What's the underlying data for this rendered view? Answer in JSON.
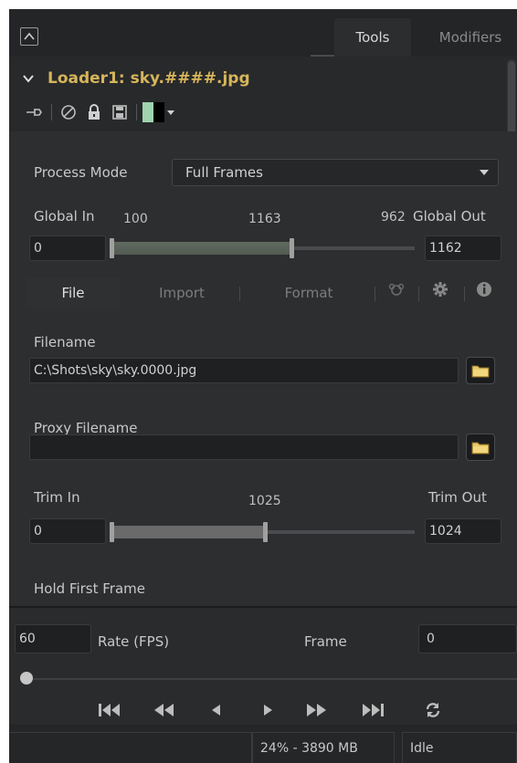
{
  "tabs": {
    "tools": "Tools",
    "modifiers": "Modifiers"
  },
  "tool": {
    "title": "Loader1: sky.####.jpg",
    "icons": [
      "pin-icon",
      "disable-icon",
      "lock-icon",
      "save-icon",
      "color-swatch",
      "chevron-down-icon"
    ],
    "swatch_colors": [
      "#9fd3ad",
      "#000000"
    ]
  },
  "process_mode": {
    "label": "Process Mode",
    "value": "Full Frames"
  },
  "global_range": {
    "in_label": "Global In",
    "out_label": "Global Out",
    "start_marker": "100",
    "end_marker": "1163",
    "length_marker": "962",
    "in_value": "0",
    "out_value": "1162"
  },
  "subtabs": [
    "File",
    "Import",
    "Format"
  ],
  "subtab_icons": [
    "link-icon",
    "gear-icon",
    "info-icon"
  ],
  "filename": {
    "label": "Filename",
    "value": "C:\\Shots\\sky\\sky.0000.jpg"
  },
  "proxy": {
    "label": "Proxy Filename",
    "value": ""
  },
  "trim": {
    "in_label": "Trim In",
    "out_label": "Trim Out",
    "marker": "1025",
    "in_value": "0",
    "out_value": "1024"
  },
  "hold_first_frame": {
    "label": "Hold First Frame"
  },
  "time": {
    "rate_value": "60",
    "rate_label": "Rate (FPS)",
    "frame_label": "Frame",
    "frame_value": "0"
  },
  "transport_icons": [
    "skip-to-start-icon",
    "rewind-icon",
    "step-back-icon",
    "play-icon",
    "fast-forward-icon",
    "skip-to-end-icon",
    "loop-icon"
  ],
  "status": {
    "memory": "24% - 3890 MB",
    "state": "Idle"
  },
  "colors": {
    "accent_title": "#d6b55a",
    "panel_bg": "#2d2e30",
    "range_green": "#5f6a5f"
  }
}
